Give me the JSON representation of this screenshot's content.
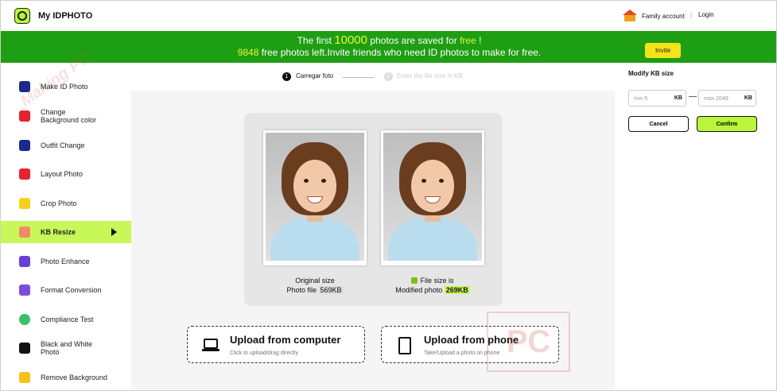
{
  "header": {
    "app_title": "My IDPHOTO",
    "family_account": "Family account",
    "separator": "|",
    "login": "Login"
  },
  "banner": {
    "line1_a": "The first ",
    "line1_count": "10000",
    "line1_b": " photos are saved for ",
    "line1_free": "free",
    "line1_c": " !",
    "line2_count": "9848",
    "line2_text": " free photos left.Invite friends who need ID photos to make for free.",
    "invite_label": "Invite",
    "colors": {
      "background": "#1e9e12",
      "highlight": "#e8f53a"
    }
  },
  "sidebar": {
    "items": [
      {
        "label": "Make ID Photo",
        "icon": "id-photo-icon"
      },
      {
        "label": "Change Background color",
        "icon": "background-color-icon"
      },
      {
        "label": "Outfit Change",
        "icon": "outfit-icon"
      },
      {
        "label": "Layout Photo",
        "icon": "layout-icon"
      },
      {
        "label": "Crop Photo",
        "icon": "crop-icon"
      },
      {
        "label": "KB Resize",
        "icon": "kb-resize-icon",
        "active": true
      },
      {
        "label": "Photo Enhance",
        "icon": "hd-enhance-icon"
      },
      {
        "label": "Format Conversion",
        "icon": "format-conversion-icon"
      },
      {
        "label": "Compliance Test",
        "icon": "compliance-check-icon"
      },
      {
        "label": "Black and White Photo",
        "icon": "black-white-icon"
      },
      {
        "label": "Remove Background",
        "icon": "remove-background-icon"
      }
    ],
    "active_color": "#c8f75a"
  },
  "steps": {
    "step1_num": "1",
    "step1_label": "Carregar foto",
    "step2_num": "2",
    "step2_label": "Enter the file size in KB"
  },
  "preview": {
    "original_title": "Original size",
    "original_prefix": "Photo file ",
    "original_size": "569KB",
    "modified_title": "File size is",
    "modified_prefix": "Modified photo ",
    "modified_size": "269KB"
  },
  "upload": {
    "computer_title": "Upload from computer",
    "computer_sub": "Click to upload/drag directly",
    "phone_title": "Upload from phone",
    "phone_sub": "Take/Upload a photo on phone"
  },
  "right_panel": {
    "title": "Modify KB size",
    "min_placeholder": "min 5",
    "max_placeholder": "max 2048",
    "unit": "KB",
    "dash": "—",
    "cancel_label": "Cancel",
    "confirm_label": "Confirm",
    "confirm_color": "#b9f53a"
  }
}
